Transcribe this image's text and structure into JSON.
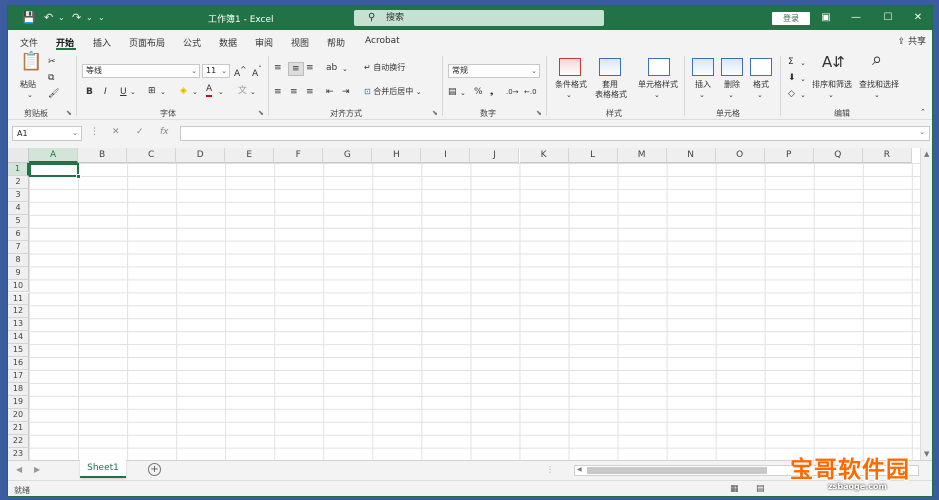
{
  "titlebar": {
    "doc_title": "工作簿1 - Excel",
    "search_label": "搜索",
    "login_label": "登录",
    "icons": [
      "save-icon",
      "undo-icon",
      "redo-icon",
      "customize-icon"
    ]
  },
  "tabs": [
    "文件",
    "开始",
    "插入",
    "页面布局",
    "公式",
    "数据",
    "审阅",
    "视图",
    "帮助",
    "Acrobat"
  ],
  "active_tab": "开始",
  "share_label": "共享",
  "ribbon": {
    "clipboard": {
      "paste": "粘贴",
      "group": "剪贴板"
    },
    "font": {
      "font_name": "等线",
      "font_size": "11",
      "bold": "B",
      "italic": "I",
      "underline": "U",
      "group": "字体"
    },
    "alignment": {
      "wrap": "自动换行",
      "merge": "合并后居中",
      "group": "对齐方式"
    },
    "number": {
      "format": "常规",
      "group": "数字"
    },
    "styles": {
      "conditional": "条件格式",
      "table_line1": "套用",
      "table_line2": "表格格式",
      "cell_styles": "单元格样式",
      "group": "样式"
    },
    "cells": {
      "insert": "插入",
      "delete": "删除",
      "format": "格式",
      "group": "单元格"
    },
    "editing": {
      "sort_filter": "排序和筛选",
      "find_select": "查找和选择",
      "group": "编辑"
    }
  },
  "formula_bar": {
    "name_box": "A1",
    "fx": "fx"
  },
  "columns": [
    "A",
    "B",
    "C",
    "D",
    "E",
    "F",
    "G",
    "H",
    "I",
    "J",
    "K",
    "L",
    "M",
    "N",
    "O",
    "P",
    "Q",
    "R"
  ],
  "rows": [
    "1",
    "2",
    "3",
    "4",
    "5",
    "6",
    "7",
    "8",
    "9",
    "10",
    "11",
    "12",
    "13",
    "14",
    "15",
    "16",
    "17",
    "18",
    "19",
    "20",
    "21",
    "22",
    "23"
  ],
  "sheet_tab": "Sheet1",
  "status": "就绪",
  "watermark": {
    "main": "宝哥软件园",
    "sub": "zsbaoge.com"
  },
  "colors": {
    "accent": "#217346"
  }
}
